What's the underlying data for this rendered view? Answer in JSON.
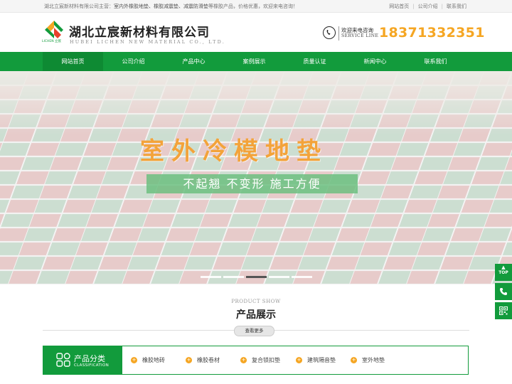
{
  "topbar": {
    "intro_prefix": "湖北立宸新材料有限公司主营：",
    "intro_products": "室内外橡胶地垫、橡胶减震垫、减震防滑垫",
    "intro_suffix": "等橡胶产品，价格优惠，欢迎来电咨询！",
    "links": [
      "网站首页",
      "公司介绍",
      "联系我们"
    ]
  },
  "header": {
    "company_name": "湖北立宸新材料有限公司",
    "company_name_en": "HUBEI LICHEN NEW MATERIAL CO., LTD.",
    "logo_text": "LICHEN 立宸",
    "service_cn": "欢迎来电咨询",
    "service_en": "SERVICE LINE",
    "phone": "18371332351",
    "brand_colors": {
      "green": "#129b3c",
      "orange": "#f5a623"
    }
  },
  "nav": {
    "items": [
      "网站首页",
      "公司介绍",
      "产品中心",
      "案例展示",
      "质量认证",
      "新闻中心",
      "联系我们"
    ],
    "active_index": 0
  },
  "banner": {
    "title": "室外冷模地垫",
    "subtitle": "不起翘  不变形  施工方便",
    "slide_count": 5,
    "active_slide": 2
  },
  "side_tools": {
    "top_label": "TOP",
    "icons": [
      "phone-icon",
      "qrcode-icon"
    ]
  },
  "products": {
    "section_en": "PRODUCT SHOW",
    "section_title": "产品展示",
    "more_label": "查看更多",
    "category_title": "产品分类",
    "category_title_en": "CLASSIFICATION",
    "categories": [
      "橡胶地砖",
      "橡胶卷材",
      "复合锁扣垫",
      "建筑隔音垫",
      "室外地垫"
    ]
  }
}
